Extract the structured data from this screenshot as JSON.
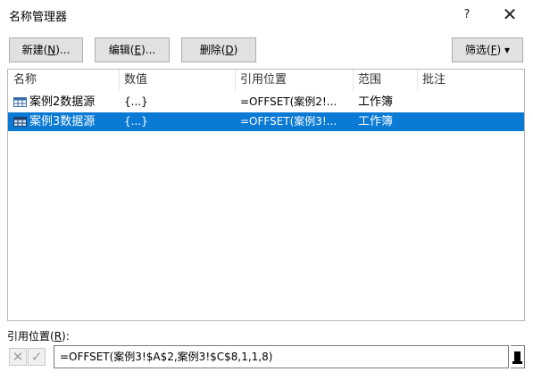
{
  "window": {
    "title": "名称管理器",
    "help_label": "?",
    "close_label": "✕"
  },
  "toolbar": {
    "new_label_pre": "新建(",
    "new_key": "N",
    "new_label_post": ")...",
    "edit_label_pre": "编辑(",
    "edit_key": "E",
    "edit_label_post": ")...",
    "delete_label_pre": "删除(",
    "delete_key": "D",
    "delete_label_post": ")",
    "filter_label_pre": "筛选(",
    "filter_key": "F",
    "filter_label_post": ") ▾"
  },
  "table": {
    "columns": [
      "名称",
      "数值",
      "引用位置",
      "范围",
      "批注"
    ],
    "rows": [
      {
        "name": "案例2数据源",
        "value": "{...}",
        "ref": "=OFFSET(案例2!...",
        "scope": "工作簿",
        "note": "",
        "selected": false
      },
      {
        "name": "案例3数据源",
        "value": "{...}",
        "ref": "=OFFSET(案例3!...",
        "scope": "工作簿",
        "note": "",
        "selected": true
      }
    ]
  },
  "refers_to": {
    "label_pre": "引用位置(",
    "label_key": "R",
    "label_post": "):",
    "value": "=OFFSET(案例3!$A$2,案例3!$C$8,1,1,8)",
    "cancel_glyph": "✕",
    "confirm_glyph": "✓"
  },
  "colors": {
    "selection": "#0a7ad4",
    "button_bg": "#e1e1e1"
  }
}
